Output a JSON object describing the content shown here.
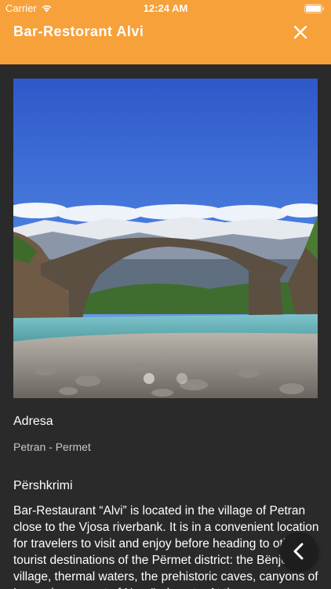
{
  "status_bar": {
    "carrier": "Carrier",
    "time": "12:24 AM",
    "wifi_icon": "wifi-icon",
    "battery_icon": "battery-icon"
  },
  "header": {
    "title": "Bar-Restorant Alvi",
    "close_icon": "close-icon",
    "background_color": "#f7a13a"
  },
  "gallery": {
    "image_subject": "stone arch bridge over river with snowy mountains",
    "dots_count": 2,
    "active_index": 0
  },
  "address": {
    "label": "Adresa",
    "value": "Petran - Permet"
  },
  "description": {
    "label": "Përshkrimi",
    "text": "Bar-Restaurant “Alvi” is located in the village of Petran close to the Vjosa riverbank. It is in a convenient location for travelers to visit and enjoy before heading to other tourist destinations of the Përmet district: the Bënjë village, thermal waters, the prehistoric caves, canyons of Langarica, mount of Nemërçka, etc. At the"
  },
  "back_button": {
    "icon": "chevron-left-icon"
  },
  "colors": {
    "accent": "#f7a13a",
    "background": "#2a2a2a"
  }
}
